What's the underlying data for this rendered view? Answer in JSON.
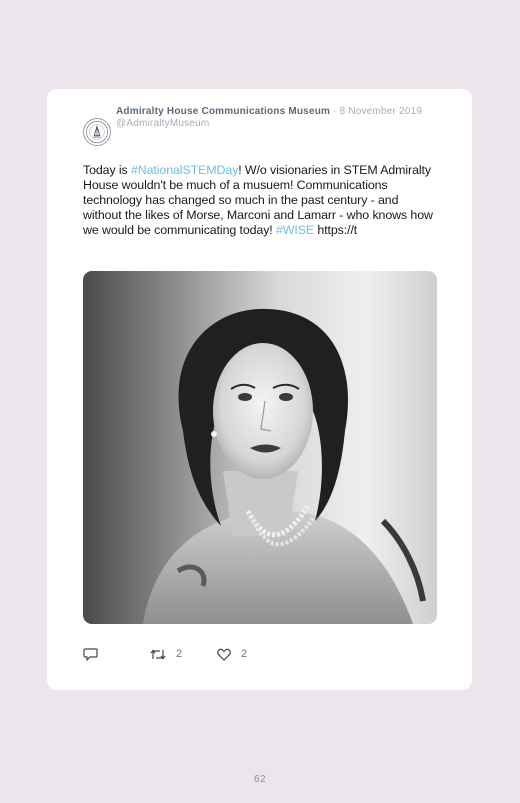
{
  "tweet": {
    "account_name": "Admiralty House Communications Museum",
    "separator": " · ",
    "date": "8 November 2019",
    "handle": "@AdmiraltyMuseum",
    "text_parts": {
      "p1": "Today is ",
      "hashtag1": "#NationalSTEMDay",
      "p2": "! W/o visionaries in STEM Admiralty House wouldn't be much of a musuem! Communications technology has changed so much in the past century - and without the likes of Morse, Marconi and Lamarr - who knows how we would be communicating today! ",
      "hashtag2": "#WISE",
      "p3": " https://t"
    },
    "hashtag_color": "#6fc0de",
    "photo_icon": "portrait-photo",
    "avatar_icon": "museum-logo-icon"
  },
  "actions": {
    "reply": {
      "icon": "reply-icon"
    },
    "retweet": {
      "icon": "retweet-icon",
      "count": "2"
    },
    "like": {
      "icon": "heart-icon",
      "count": "2"
    }
  },
  "page": {
    "number": "62"
  }
}
